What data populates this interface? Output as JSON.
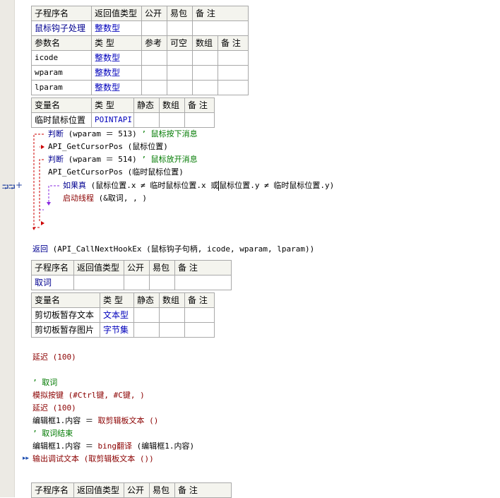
{
  "sub1": {
    "header": [
      "子程序名",
      "返回值类型",
      "公开",
      "易包",
      "备 注"
    ],
    "row": [
      "鼠标钩子处理",
      "整数型",
      "",
      "",
      ""
    ],
    "param_header": [
      "参数名",
      "类 型",
      "参考",
      "可空",
      "数组",
      "备 注"
    ],
    "params": [
      [
        "icode",
        "整数型"
      ],
      [
        "wparam",
        "整数型"
      ],
      [
        "lparam",
        "整数型"
      ]
    ]
  },
  "vars1": {
    "header": [
      "变量名",
      "类 型",
      "静态",
      "数组",
      "备 注"
    ],
    "rows": [
      [
        "临时鼠标位置",
        "POINTAPI"
      ]
    ]
  },
  "code1": {
    "l1_kw": "判断",
    "l1_args": " (wparam ＝ 513) ",
    "l1_cmt": "’ 鼠标按下消息",
    "l2": "API_GetCursorPos (鼠标位置)",
    "l3_kw": "判断",
    "l3_args": " (wparam ＝ 514) ",
    "l3_cmt": "’ 鼠标放开消息",
    "l4": "API_GetCursorPos (临时鼠标位置)",
    "l5_kw": "如果真",
    "l5_args_a": " (鼠标位置.x ≠ 临时鼠标位置.x 或",
    "l5_args_b": "鼠标位置.y ≠ 临时鼠标位置.y)",
    "l6_kw": "启动线程",
    "l6_args": " (&取词, , )",
    "ret_kw": "返回",
    "ret_args": " (API_CallNextHookEx (鼠标钩子句柄, icode, wparam, lparam))"
  },
  "sub2": {
    "header": [
      "子程序名",
      "返回值类型",
      "公开",
      "易包",
      "备 注"
    ],
    "row": [
      "取词",
      "",
      "",
      "",
      ""
    ]
  },
  "vars2": {
    "header": [
      "变量名",
      "类 型",
      "静态",
      "数组",
      "备 注"
    ],
    "rows": [
      [
        "剪切板暂存文本",
        "文本型"
      ],
      [
        "剪切板暂存图片",
        "字节集"
      ]
    ]
  },
  "code2": {
    "delay1": "延迟 (100)",
    "cmt1": "’ 取词",
    "keypress": "模拟按键 (#Ctrl键, #C键, )",
    "delay2": "延迟 (100)",
    "assign1_a": "编辑框1.内容 ＝ ",
    "assign1_b": "取剪辑板文本 ()",
    "cmt2": "’ 取词结束",
    "assign2_a": "编辑框1.内容 ＝ ",
    "assign2_b": "bing翻译",
    "assign2_c": " (编辑框1.内容)",
    "debug": "输出调试文本 (取剪辑板文本 ())"
  },
  "sub3": {
    "header": [
      "子程序名",
      "返回值类型",
      "公开",
      "易包",
      "备 注"
    ]
  },
  "colors": {
    "type": "#0000bb",
    "keyword": "#000090",
    "comment": "#007a00",
    "flow_red": "#cc0000",
    "flow_blue": "#2020c0",
    "flow_purple": "#8a2be2"
  },
  "icons": [
    "bookmark-arrow-icon",
    "expand-icon",
    "run-arrow-icon"
  ]
}
